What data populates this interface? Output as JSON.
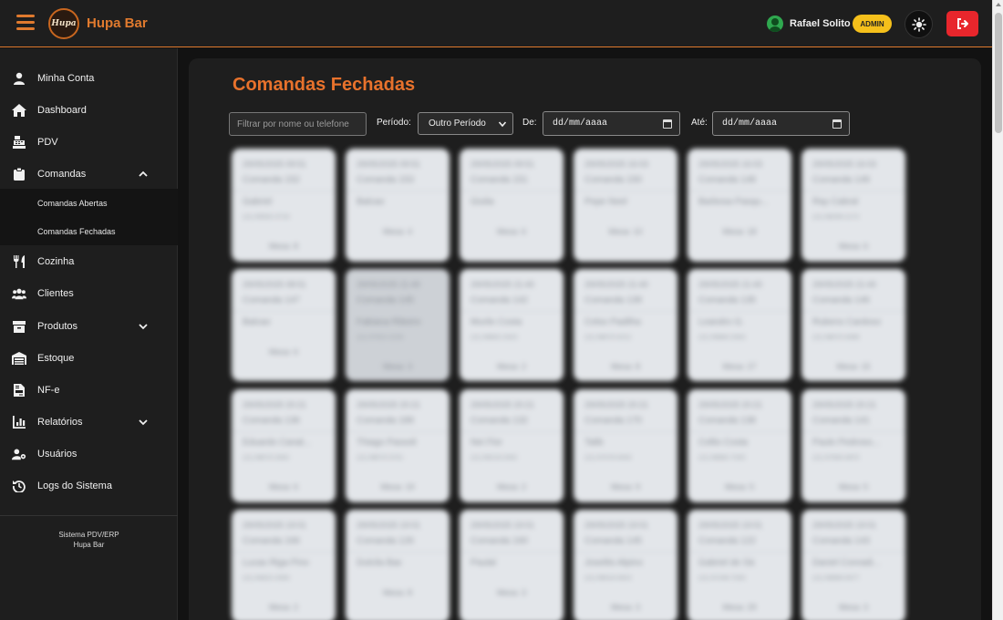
{
  "header": {
    "brand": "Hupa Bar",
    "logo_text": "Hupa",
    "user_name": "Rafael Solito",
    "role_badge": "ADMIN"
  },
  "sidebar": {
    "items": [
      {
        "label": "Minha Conta",
        "icon": "user-icon"
      },
      {
        "label": "Dashboard",
        "icon": "home-icon"
      },
      {
        "label": "PDV",
        "icon": "cash-register-icon"
      },
      {
        "label": "Comandas",
        "icon": "clipboard-icon"
      },
      {
        "label": "Cozinha",
        "icon": "utensils-icon"
      },
      {
        "label": "Clientes",
        "icon": "users-icon"
      },
      {
        "label": "Produtos",
        "icon": "box-icon"
      },
      {
        "label": "Estoque",
        "icon": "warehouse-icon"
      },
      {
        "label": "NF-e",
        "icon": "file-invoice-icon"
      },
      {
        "label": "Relatórios",
        "icon": "chart-icon"
      },
      {
        "label": "Usuários",
        "icon": "user-gear-icon"
      },
      {
        "label": "Logs do Sistema",
        "icon": "history-icon"
      }
    ],
    "submenu": [
      "Comandas Abertas",
      "Comandas Fechadas"
    ],
    "footer_line1": "Sistema PDV/ERP",
    "footer_line2": "Hupa Bar"
  },
  "main": {
    "title": "Comandas Fechadas",
    "search_placeholder": "Filtrar por nome ou telefone",
    "period_label": "Período:",
    "period_value": "Outro Período",
    "from_label": "De:",
    "from_value": "dd/mm/aaaa",
    "to_label": "Até:",
    "to_value": "dd/mm/aaaa"
  },
  "cards": [
    {
      "top": "29/05/2025 09:51",
      "comanda": "Comanda 152",
      "name": "Gabriel",
      "phone": "(11) 95502-3719",
      "mesa": "Mesa: 8"
    },
    {
      "top": "29/05/2025 09:51",
      "comanda": "Comanda 153",
      "name": "Balcao",
      "phone": "",
      "mesa": "Mesa: 4"
    },
    {
      "top": "29/05/2025 09:51",
      "comanda": "Comanda 151",
      "name": "Giulia",
      "phone": "",
      "mesa": "Mesa: 6"
    },
    {
      "top": "29/05/2025 16:03",
      "comanda": "Comanda 150",
      "name": "Pepe Neel",
      "phone": "",
      "mesa": "Mesa: 10"
    },
    {
      "top": "29/05/2025 16:03",
      "comanda": "Comanda 148",
      "name": "Barbosa Pasqu...",
      "phone": "",
      "mesa": "Mesa: 18"
    },
    {
      "top": "29/05/2025 16:03",
      "comanda": "Comanda 149",
      "name": "Ray Cabral",
      "phone": "(11) 98256-2172",
      "mesa": "Mesa: 6"
    },
    {
      "top": "29/05/2025 08:51",
      "comanda": "Comanda 147",
      "name": "Balcao",
      "phone": "",
      "mesa": "Mesa: 6"
    },
    {
      "top": "29/05/2025 21:40",
      "comanda": "Comanda 145",
      "name": "Fabiana Ribeiro",
      "phone": "(11) 97922-2226",
      "mesa": "Mesa: 3"
    },
    {
      "top": "29/05/2025 21:40",
      "comanda": "Comanda 142",
      "name": "Murilo Costa",
      "phone": "(11) 99902-2023",
      "mesa": "Mesa: 2"
    },
    {
      "top": "29/05/2025 21:40",
      "comanda": "Comanda 139",
      "name": "Celso Padilha",
      "phone": "(11) 98070-4212",
      "mesa": "Mesa: 8"
    },
    {
      "top": "29/05/2025 21:40",
      "comanda": "Comanda 135",
      "name": "Leandro G.",
      "phone": "(11) 95860-2003",
      "mesa": "Mesa: 27"
    },
    {
      "top": "29/05/2025 21:40",
      "comanda": "Comanda 146",
      "name": "Rubens Cardoso",
      "phone": "(11) 98070-4099",
      "mesa": "Mesa: 15"
    },
    {
      "top": "29/05/2025 20:21",
      "comanda": "Comanda 136",
      "name": "Eduardo Canal...",
      "phone": "(11) 98070-2842",
      "mesa": "Mesa: 6"
    },
    {
      "top": "29/05/2025 20:21",
      "comanda": "Comanda 189",
      "name": "Thiago Passoli",
      "phone": "(11) 98070-3701",
      "mesa": "Mesa: 19"
    },
    {
      "top": "29/05/2025 20:21",
      "comanda": "Comanda 132",
      "name": "Nei Flor",
      "phone": "(11) 99218-2002",
      "mesa": "Mesa: 2"
    },
    {
      "top": "29/05/2025 20:21",
      "comanda": "Comanda 170",
      "name": "Talib",
      "phone": "(11) 97078-4033",
      "mesa": "Mesa: 9"
    },
    {
      "top": "29/05/2025 20:21",
      "comanda": "Comanda 138",
      "name": "Cellio Costa",
      "phone": "(11) 98882-7025",
      "mesa": "Mesa: 5"
    },
    {
      "top": "29/05/2025 20:21",
      "comanda": "Comanda 141",
      "name": "Paulo Pedroso...",
      "phone": "(11) 97084-4870",
      "mesa": "Mesa: 5"
    },
    {
      "top": "29/05/2025 19:01",
      "comanda": "Comanda 166",
      "name": "Lucas Riga Pino",
      "phone": "(11) 94622-2093",
      "mesa": "Mesa: 2"
    },
    {
      "top": "29/05/2025 19:01",
      "comanda": "Comanda 126",
      "name": "Dulcila Bac",
      "phone": "",
      "mesa": "Mesa: 8"
    },
    {
      "top": "29/05/2025 19:01",
      "comanda": "Comanda 160",
      "name": "Paulal",
      "phone": "",
      "mesa": "Mesa: 3"
    },
    {
      "top": "29/05/2025 19:01",
      "comanda": "Comanda 145",
      "name": "Joselito Alpino",
      "phone": "(11) 99018-3023",
      "mesa": "Mesa: 3"
    },
    {
      "top": "29/05/2025 19:01",
      "comanda": "Comanda 122",
      "name": "Gabriel de Sá",
      "phone": "(11) 97246-7026",
      "mesa": "Mesa: 29"
    },
    {
      "top": "29/05/2025 19:01",
      "comanda": "Comanda 143",
      "name": "Daniel Conradi...",
      "phone": "(11) 99899-5077",
      "mesa": "Mesa: 3"
    }
  ]
}
